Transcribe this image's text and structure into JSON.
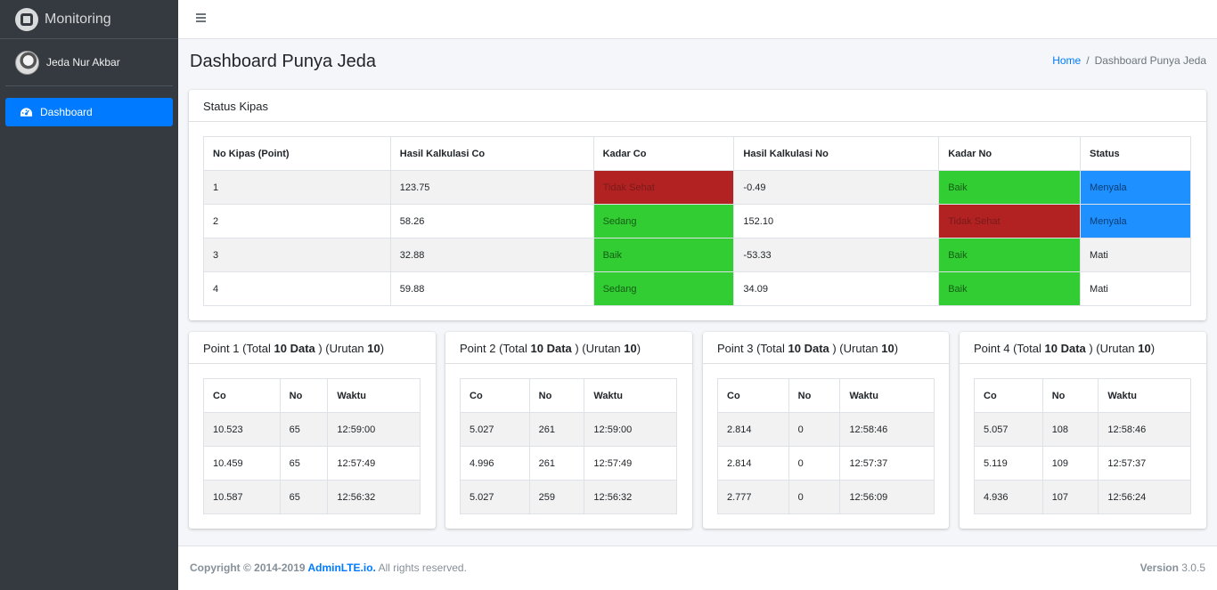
{
  "brand": {
    "name": "Monitoring"
  },
  "user": {
    "name": "Jeda Nur Akbar"
  },
  "sidebar": {
    "items": [
      {
        "label": "Dashboard",
        "icon": "tachometer-icon"
      }
    ]
  },
  "header": {
    "title": "Dashboard Punya Jeda",
    "breadcrumb": {
      "home": "Home",
      "current": "Dashboard Punya Jeda"
    }
  },
  "status_card": {
    "title": "Status Kipas",
    "columns": [
      "No Kipas (Point)",
      "Hasil Kalkulasi Co",
      "Kadar Co",
      "Hasil Kalkulasi No",
      "Kadar No",
      "Status"
    ],
    "rows": [
      [
        "1",
        "123.75",
        "Tidak Sehat",
        "-0.49",
        "Baik",
        "Menyala"
      ],
      [
        "2",
        "58.26",
        "Sedang",
        "152.10",
        "Tidak Sehat",
        "Menyala"
      ],
      [
        "3",
        "32.88",
        "Baik",
        "-53.33",
        "Baik",
        "Mati"
      ],
      [
        "4",
        "59.88",
        "Sedang",
        "34.09",
        "Baik",
        "Mati"
      ]
    ]
  },
  "colors": {
    "bad": "#b22222",
    "good": "#32cd32",
    "on": "#1e90ff",
    "accent": "#007bff"
  },
  "points": [
    {
      "prefix": "Point 1 (Total ",
      "total": "10 Data",
      "mid": " ) (Urutan ",
      "order": "10",
      "suffix": ")",
      "columns": [
        "Co",
        "No",
        "Waktu"
      ],
      "rows": [
        [
          "10.523",
          "65",
          "12:59:00"
        ],
        [
          "10.459",
          "65",
          "12:57:49"
        ],
        [
          "10.587",
          "65",
          "12:56:32"
        ]
      ]
    },
    {
      "prefix": "Point 2 (Total ",
      "total": "10 Data",
      "mid": " ) (Urutan ",
      "order": "10",
      "suffix": ")",
      "columns": [
        "Co",
        "No",
        "Waktu"
      ],
      "rows": [
        [
          "5.027",
          "261",
          "12:59:00"
        ],
        [
          "4.996",
          "261",
          "12:57:49"
        ],
        [
          "5.027",
          "259",
          "12:56:32"
        ]
      ]
    },
    {
      "prefix": "Point 3 (Total ",
      "total": "10 Data",
      "mid": " ) (Urutan ",
      "order": "10",
      "suffix": ")",
      "columns": [
        "Co",
        "No",
        "Waktu"
      ],
      "rows": [
        [
          "2.814",
          "0",
          "12:58:46"
        ],
        [
          "2.814",
          "0",
          "12:57:37"
        ],
        [
          "2.777",
          "0",
          "12:56:09"
        ]
      ]
    },
    {
      "prefix": "Point 4 (Total ",
      "total": "10 Data",
      "mid": " ) (Urutan ",
      "order": "10",
      "suffix": ")",
      "columns": [
        "Co",
        "No",
        "Waktu"
      ],
      "rows": [
        [
          "5.057",
          "108",
          "12:58:46"
        ],
        [
          "5.119",
          "109",
          "12:57:37"
        ],
        [
          "4.936",
          "107",
          "12:56:24"
        ]
      ]
    }
  ],
  "footer": {
    "copyright": "Copyright © 2014-2019 ",
    "link": "AdminLTE.io.",
    "rights": " All rights reserved.",
    "version_label": "Version",
    "version": " 3.0.5"
  }
}
